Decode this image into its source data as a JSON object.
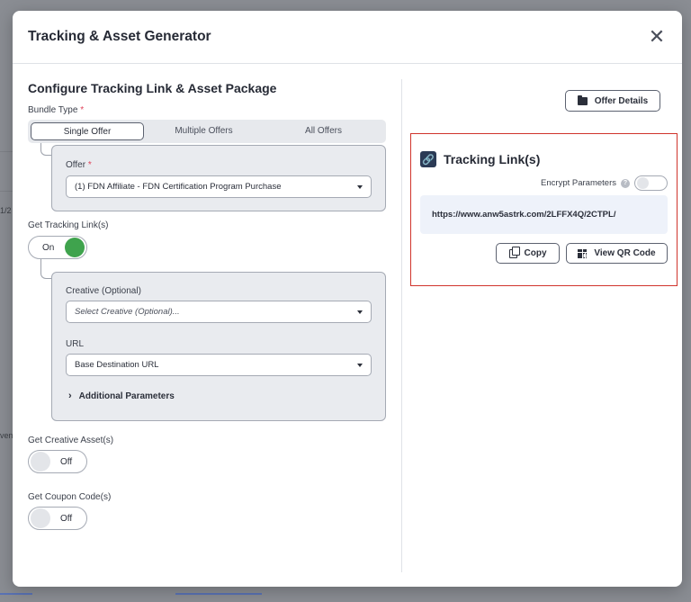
{
  "modal": {
    "title": "Tracking & Asset Generator",
    "close_glyph": "✕"
  },
  "configure": {
    "title": "Configure Tracking Link & Asset Package",
    "bundle_type_label": "Bundle Type",
    "required_mark": "*",
    "bundle_options": [
      "Single Offer",
      "Multiple Offers",
      "All Offers"
    ],
    "bundle_selected": "Single Offer",
    "offer_label": "Offer",
    "offer_value": "(1) FDN Affiliate - FDN Certification Program Purchase",
    "get_tracking_label": "Get Tracking Link(s)",
    "tracking_toggle": "On",
    "creative_label": "Creative (Optional)",
    "creative_placeholder": "Select Creative (Optional)...",
    "url_label": "URL",
    "url_value": "Base Destination URL",
    "additional_params": "Additional Parameters",
    "get_creative_label": "Get Creative Asset(s)",
    "creative_toggle": "Off",
    "get_coupon_label": "Get Coupon Code(s)",
    "coupon_toggle": "Off"
  },
  "right": {
    "offer_details_button": "Offer Details",
    "tracking_title": "Tracking Link(s)",
    "encrypt_label": "Encrypt Parameters",
    "help_glyph": "?",
    "tracking_url": "https://www.anw5astrk.com/2LFFX4Q/2CTPL/",
    "copy_button": "Copy",
    "qr_button": "View QR Code"
  },
  "backdrop": {
    "fragment_1": "1/2",
    "fragment_2": "ven"
  },
  "colors": {
    "accent_green": "#3fa34d",
    "highlight_red": "#d0342c",
    "url_bg": "#eef2fa"
  }
}
